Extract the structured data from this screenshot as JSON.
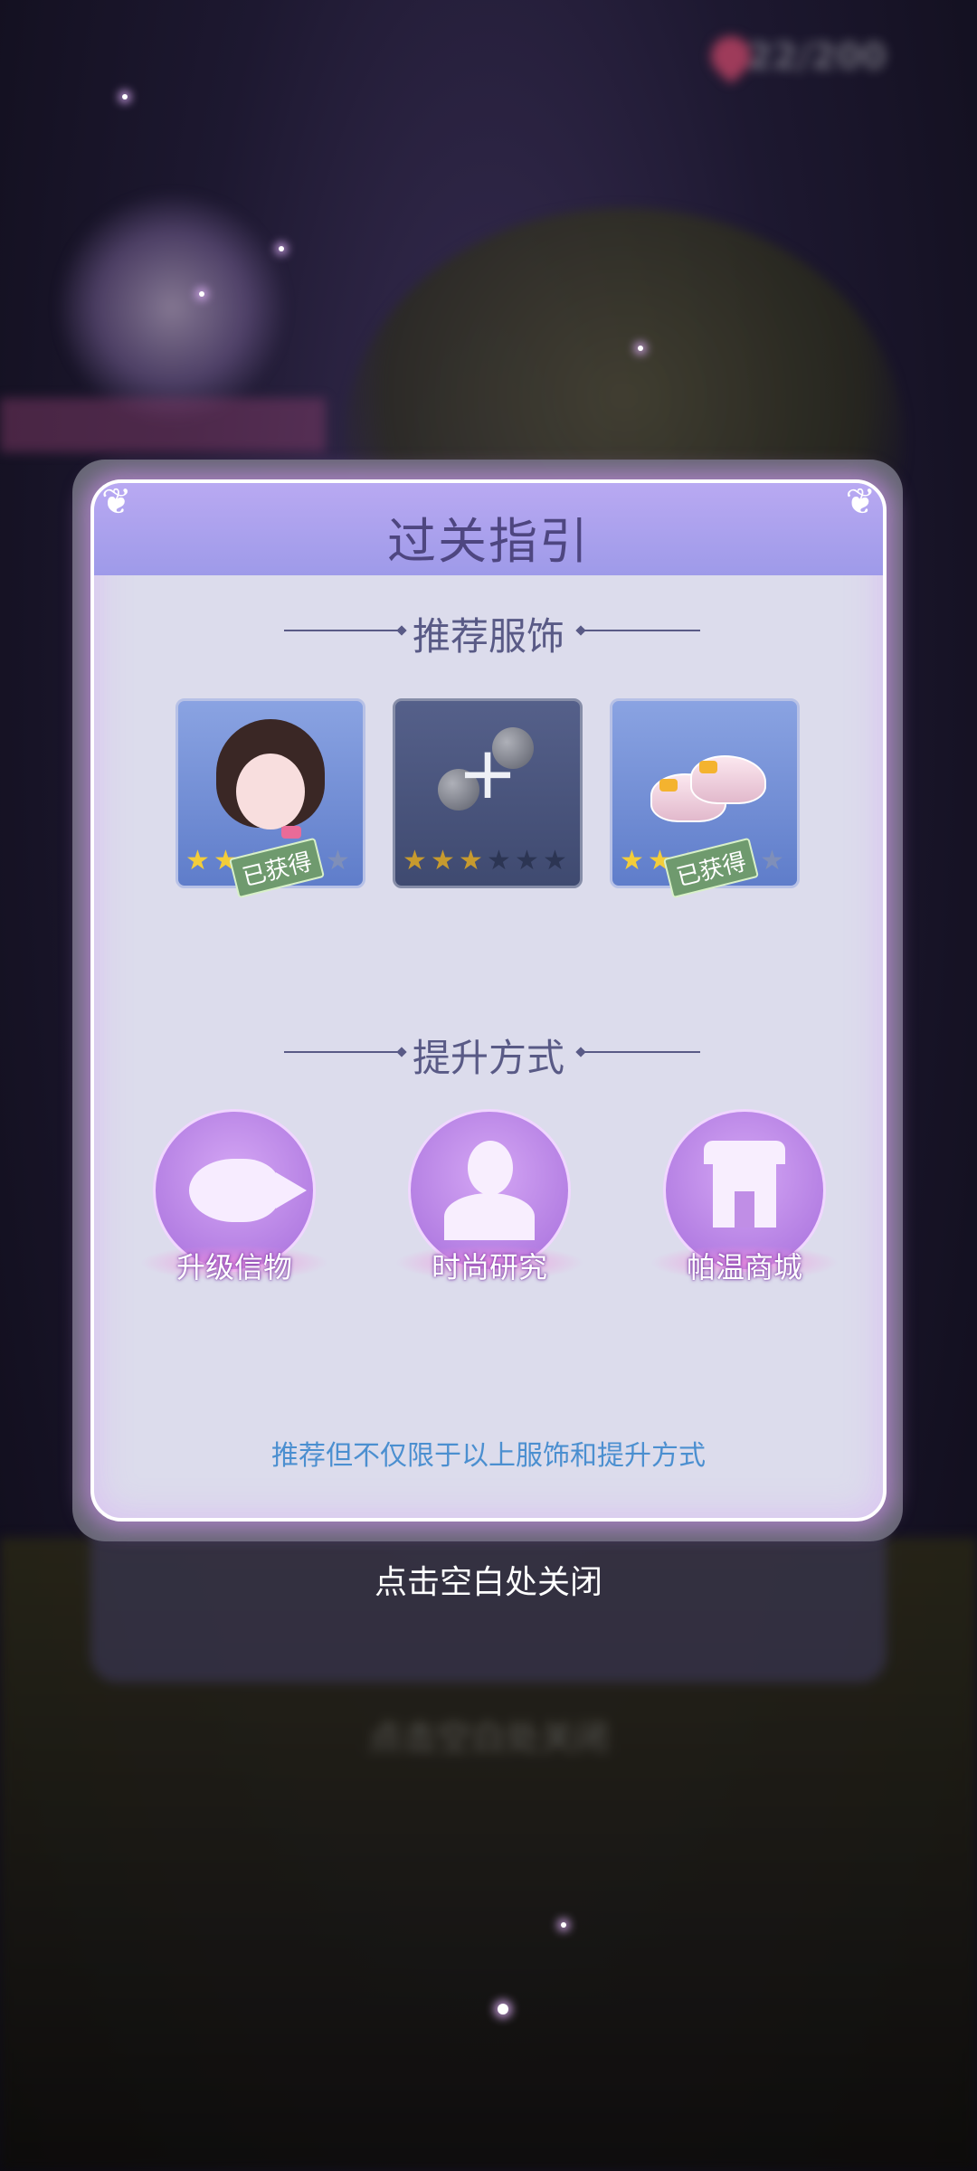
{
  "background": {
    "counter_text": "22/200",
    "lower_hint": "点击空白处关闭"
  },
  "modal": {
    "title": "过关指引",
    "section_outfits": "推荐服饰",
    "outfits": [
      {
        "name": "hair",
        "stars_on": 2,
        "stars_total": 6,
        "badge": "已获得"
      },
      {
        "name": "empty-slot",
        "stars_on": 3,
        "stars_total": 6,
        "badge": ""
      },
      {
        "name": "shoes",
        "stars_on": 2,
        "stars_total": 6,
        "badge": "已获得"
      }
    ],
    "section_methods": "提升方式",
    "methods": [
      {
        "label": "升级信物",
        "icon": "fish-icon"
      },
      {
        "label": "时尚研究",
        "icon": "silhouette-icon"
      },
      {
        "label": "帕温商城",
        "icon": "shop-icon"
      }
    ],
    "footer_note": "推荐但不仅限于以上服饰和提升方式"
  },
  "close_hint": "点击空白处关闭",
  "colors": {
    "accent": "#9e9ae9",
    "title_text": "#4e4680",
    "note_text": "#4b8fd0",
    "star_on": "#f3cd3a"
  }
}
